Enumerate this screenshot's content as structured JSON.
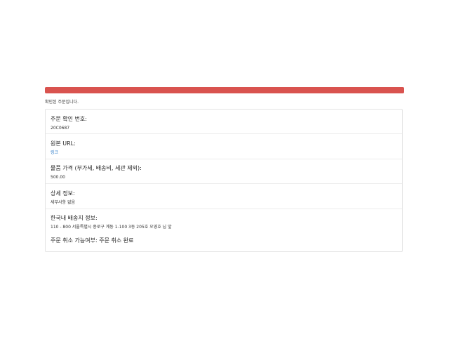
{
  "progress": {
    "fraction": 1.0,
    "color": "#d9534f"
  },
  "intro_text": "확인된 주문입니다.",
  "order": {
    "number_label": "주문 확인 번호:",
    "number_value": "20C0687",
    "url_label": "원본 URL:",
    "url_value": "링크",
    "price_label": "물품 가격 (부가세, 배송비, 세관 제외):",
    "price_value": "500.00",
    "details_label": "상세 정보:",
    "details_value": "세부사항 없음",
    "shipping_label": "한국내 배송지 정보:",
    "shipping_value": "110 - 800 서울특별시 종로구 계동 1-100 3동 205호 오영호 님 앞",
    "cancel_text": "주문 취소 가능여부: 주문 취소 완료"
  },
  "colors": {
    "link": "#2a7ac7",
    "border": "#e3e3e3"
  }
}
